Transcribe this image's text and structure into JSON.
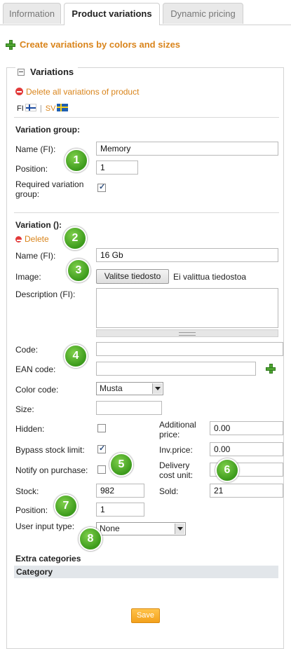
{
  "tabs": [
    "Information",
    "Product variations",
    "Dynamic pricing"
  ],
  "create_link": "Create variations by colors and sizes",
  "section_title": "Variations",
  "delete_all": "Delete all variations of product",
  "languages": {
    "fi": "FI",
    "sep": "|",
    "sv": "SV"
  },
  "group": {
    "heading": "Variation group:",
    "name_label": "Name (FI):",
    "name_value": "Memory",
    "position_label": "Position:",
    "position_value": "1",
    "required_label_1": "Required variation",
    "required_label_2": "group:",
    "required_checked": true
  },
  "variation": {
    "heading": "Variation ():",
    "delete": "Delete",
    "name_label": "Name (FI):",
    "name_value": "16 Gb",
    "image_label": "Image:",
    "file_button": "Valitse tiedosto",
    "file_status": "Ei valittua tiedostoa",
    "description_label": "Description (FI):",
    "code_label": "Code:",
    "code_value": "",
    "ean_label": "EAN code:",
    "ean_value": "",
    "color_label": "Color code:",
    "color_value": "Musta",
    "size_label": "Size:",
    "size_value": "",
    "hidden_label": "Hidden:",
    "hidden_checked": false,
    "additional_price_label_1": "Additional",
    "additional_price_label_2": "price:",
    "additional_price_value": "0.00",
    "bypass_label": "Bypass stock limit:",
    "bypass_checked": true,
    "inv_price_label": "Inv.price:",
    "inv_price_value": "0.00",
    "notify_label": "Notify on purchase:",
    "notify_checked": false,
    "delivery_label_1": "Delivery",
    "delivery_label_2": "cost unit:",
    "delivery_value": "",
    "stock_label": "Stock:",
    "stock_value": "982",
    "sold_label": "Sold:",
    "sold_value": "21",
    "position_label": "Position:",
    "position_value": "1",
    "user_input_label": "User input type:",
    "user_input_value": "None"
  },
  "extra_categories": {
    "heading": "Extra categories",
    "column": "Category"
  },
  "save_label": "Save",
  "badges": [
    "1",
    "2",
    "3",
    "4",
    "5",
    "6",
    "7",
    "8"
  ],
  "colors": {
    "accent_orange": "#d9841b",
    "badge_green": "#4fa532",
    "save_orange": "#f3a11c"
  }
}
